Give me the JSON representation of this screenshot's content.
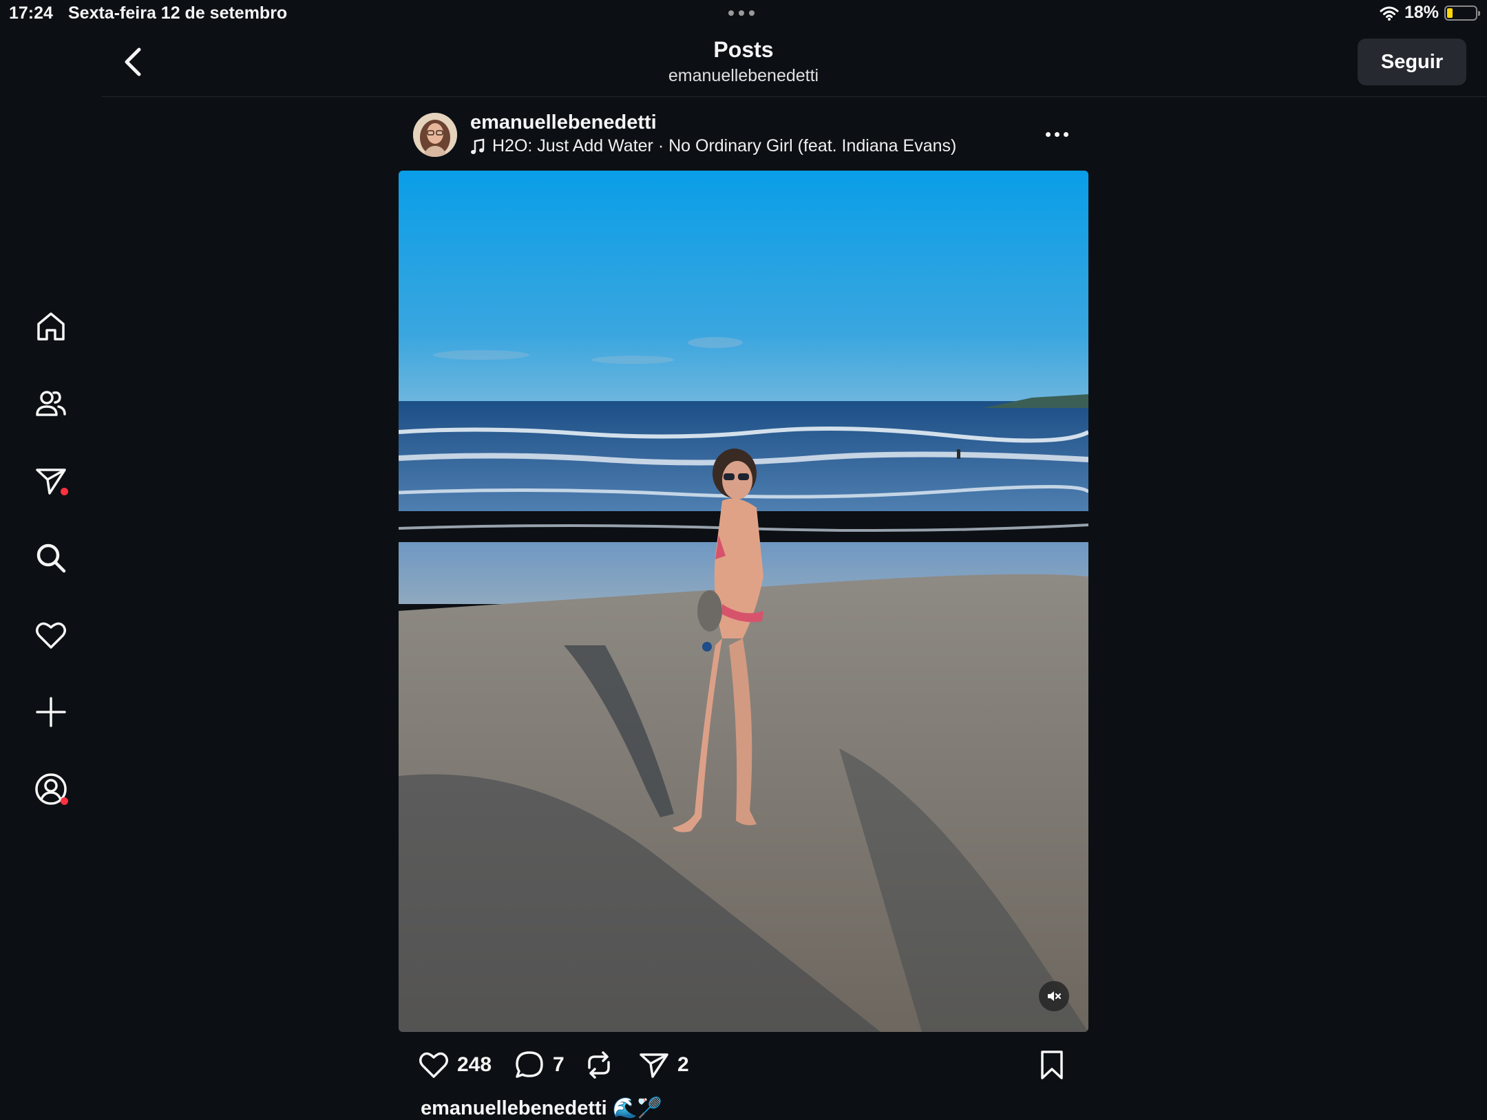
{
  "status_bar": {
    "time": "17:24",
    "date": "Sexta-feira 12 de setembro",
    "battery_percent": "18%",
    "battery_level": 0.18
  },
  "sidebar": {
    "items": [
      {
        "name": "home",
        "icon": "home-icon"
      },
      {
        "name": "profiles",
        "icon": "profiles-icon"
      },
      {
        "name": "messages",
        "icon": "paper-plane-icon",
        "badge": true
      },
      {
        "name": "search",
        "icon": "search-icon"
      },
      {
        "name": "activity",
        "icon": "heart-icon"
      },
      {
        "name": "create",
        "icon": "plus-icon"
      },
      {
        "name": "profile",
        "icon": "user-circle-icon",
        "badge": true
      }
    ]
  },
  "header": {
    "title": "Posts",
    "subtitle": "emanuellebenedetti",
    "follow_label": "Seguir"
  },
  "post": {
    "username": "emanuellebenedetti",
    "music": "H2O: Just Add Water · No Ordinary Girl (feat. Indiana Evans)",
    "likes": "248",
    "comments": "7",
    "shares": "2",
    "caption_user": "emanuellebenedetti",
    "caption_emoji": "🌊🏸"
  },
  "colors": {
    "background": "#0c1014",
    "notification_dot": "#ff3040",
    "button": "#262a30",
    "battery": "#ffd60a"
  }
}
